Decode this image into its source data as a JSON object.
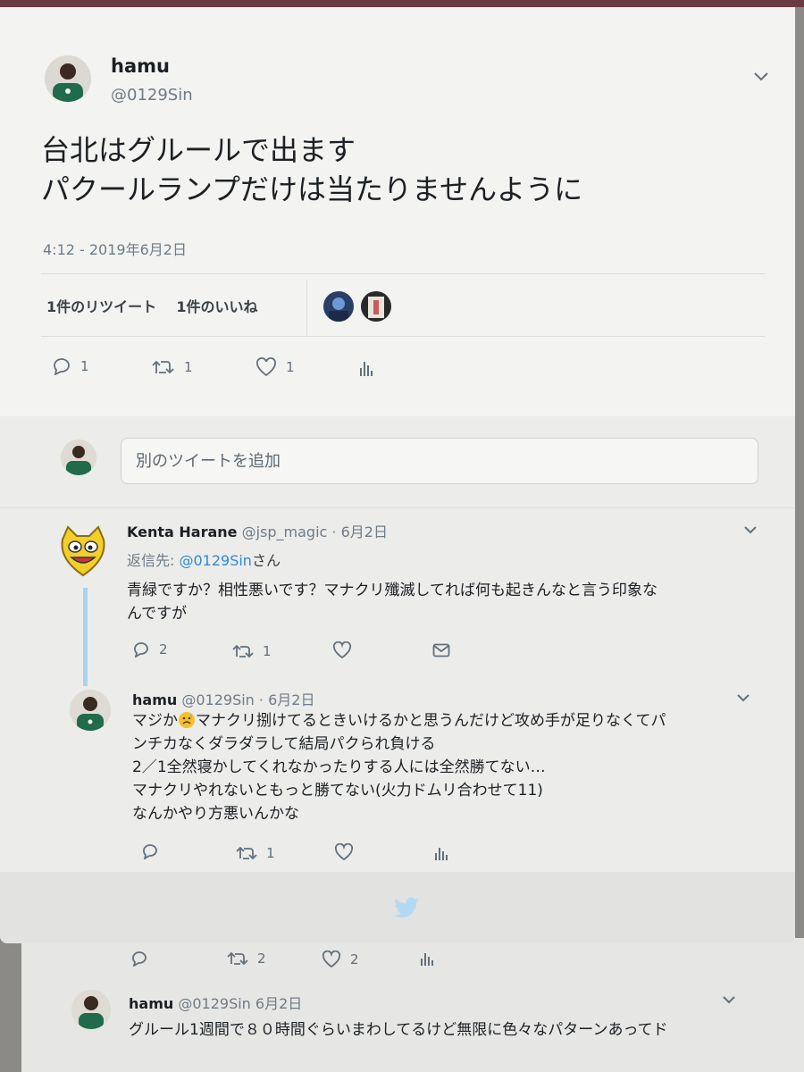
{
  "main_tweet": {
    "display_name": "hamu",
    "handle": "@0129Sin",
    "text_lines": [
      "台北はグルールで出ます",
      "パクールランプだけは当たりませんように"
    ],
    "timestamp": "4:12 - 2019年6月2日",
    "retweets_label": "1件のリツイート",
    "likes_label": "1件のいいね",
    "stats": {
      "replies": "1",
      "retweets": "1",
      "likes": "1"
    }
  },
  "compose": {
    "placeholder": "別のツイートを追加"
  },
  "replies": [
    {
      "display_name": "Kenta Harane",
      "handle": "@jsp_magic",
      "date": "· 6月2日",
      "reply_to_prefix": "返信先: ",
      "reply_to_handle": "@0129Sin",
      "reply_to_suffix": "さん",
      "text_lines": [
        "青緑ですか？相性悪いです？マナクリ殲滅してれば何も起きんなと言う印象な",
        "んですが"
      ],
      "stats": {
        "replies": "2",
        "retweets": "1"
      }
    },
    {
      "display_name": "hamu",
      "handle": "@0129Sin",
      "date": "· 6月2日",
      "text_line1_a": "マジか",
      "text_line1_b": "マナクリ捌けてるときいけるかと思うんだけど攻め手が足りなくてパ",
      "text_lines": [
        "ンチカなくダラダラして結局パクられ負ける",
        "2／1全然寝かしてくれなかったりする人には全然勝てない…",
        "マナクリやれないともっと勝てない(火力ドムリ合わせて11)",
        "なんかやり方悪いんかな"
      ],
      "stats": {
        "retweets": "1"
      }
    }
  ],
  "background": {
    "stats": {
      "retweets": "2",
      "likes": "2"
    },
    "tweet": {
      "display_name": "hamu",
      "handle": "@0129Sin",
      "date": "6月2日",
      "text": "グルール1週間で８０時間ぐらいまわしてるけど無限に色々なパターンあってド"
    }
  },
  "colors": {
    "accent": "#2f8ad4",
    "thread_line": "#a9d3f0",
    "twitter_bird": "#b3d8f2"
  }
}
